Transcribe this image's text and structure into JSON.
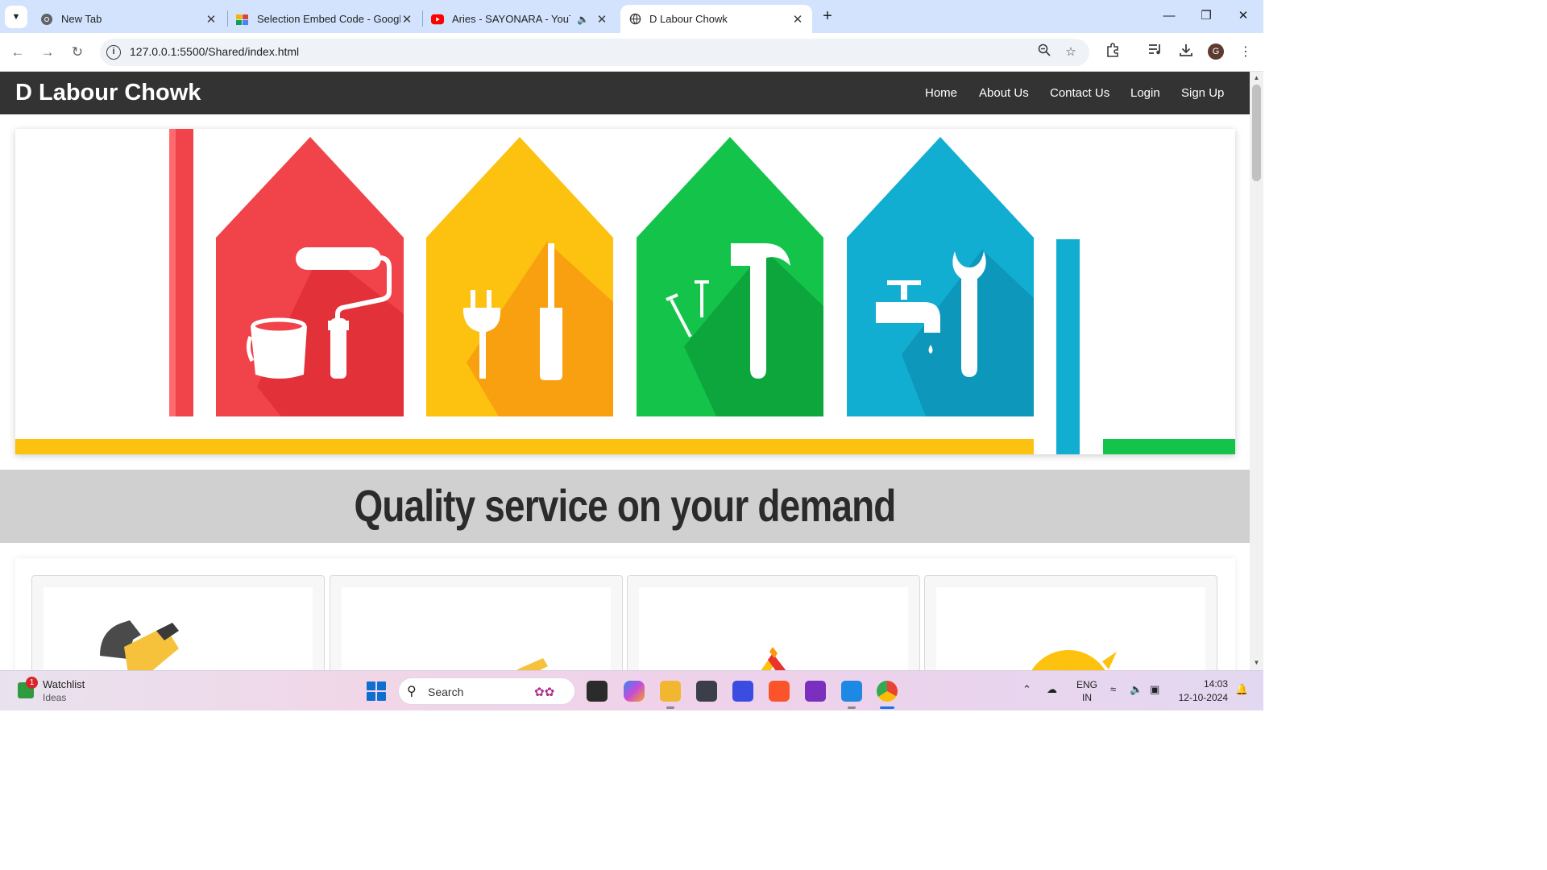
{
  "browser": {
    "tabs": [
      {
        "title": "New Tab",
        "icon": "chrome-icon"
      },
      {
        "title": "Selection Embed Code - Google",
        "icon": "embed-code-icon"
      },
      {
        "title": "Aries - SAYONARA - YouTube",
        "icon": "youtube-icon"
      },
      {
        "title": "D Labour Chowk",
        "icon": "globe-icon"
      }
    ],
    "active_tab_index": 3,
    "url": "127.0.0.1:5500/Shared/index.html",
    "profile_initial": "G"
  },
  "site": {
    "brand": "D Labour Chowk",
    "nav": {
      "home": "Home",
      "about": "About Us",
      "contact": "Contact Us",
      "login": "Login",
      "signup": "Sign Up"
    },
    "tagline": "Quality service on your demand",
    "hero_tools": [
      "paint-roller-icon",
      "electric-plug-screwdriver-icon",
      "hammer-nails-icon",
      "tap-wrench-icon"
    ],
    "service_icons": [
      "pipe-wrench-icon",
      "pencil-icon",
      "roof-icon",
      "sun-icon"
    ]
  },
  "colors": {
    "nav_bg": "#333333",
    "red_house": "#f0434a",
    "yellow_house": "#fcc20f",
    "green_house": "#14c44a",
    "blue_house": "#12aed2"
  },
  "taskbar": {
    "widget_title": "Watchlist",
    "widget_sub": "Ideas",
    "widget_badge": "1",
    "search_placeholder": "Search",
    "lang_top": "ENG",
    "lang_bottom": "IN",
    "time": "14:03",
    "date": "12-10-2024"
  }
}
